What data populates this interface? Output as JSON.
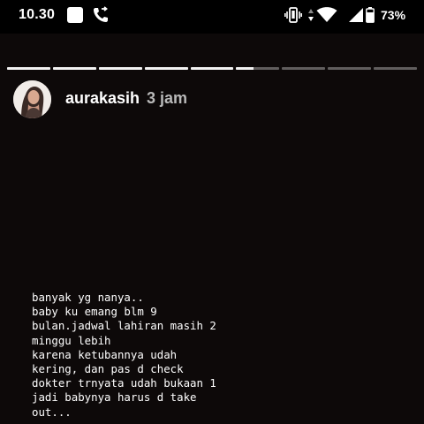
{
  "status_bar": {
    "time": "10.30",
    "battery": "73%",
    "icons": [
      "notification-square-icon",
      "call-forward-icon",
      "vibrate-icon",
      "data-arrows-icon",
      "wifi-icon",
      "cell-signal-icon",
      "battery-icon"
    ]
  },
  "story": {
    "segments_total": 9,
    "segments_completed": 5,
    "current_segment_progress": 0.4,
    "username": "aurakasih",
    "time_ago": "3 jam",
    "lines": [
      "banyak yg nanya..",
      "baby ku emang blm 9",
      "bulan.jadwal lahiran masih 2",
      "minggu lebih",
      "karena ketubannya udah",
      "kering, dan pas d check",
      "dokter trnyata udah bukaan 1",
      "jadi babynya harus d take",
      "out..."
    ]
  },
  "colors": {
    "background": "#0d0909",
    "progress_filled": "#f2f2f2",
    "progress_empty": "rgba(255,255,255,0.35)",
    "time_ago_text": "#b9b9b9"
  }
}
